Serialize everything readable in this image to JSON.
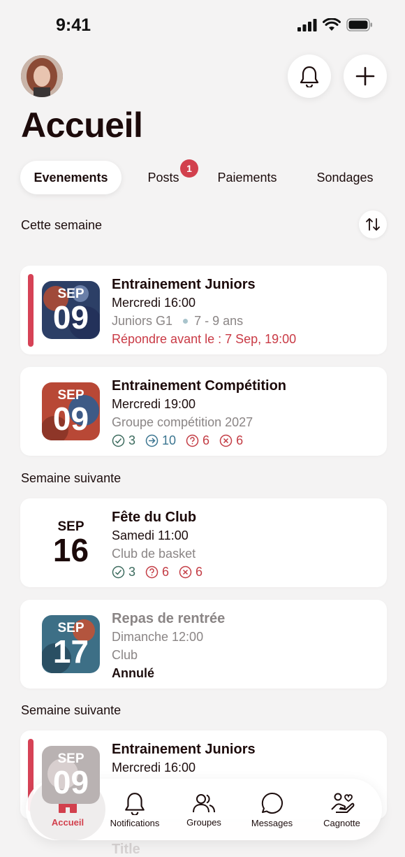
{
  "status": {
    "time": "9:41"
  },
  "header": {
    "title": "Accueil"
  },
  "tabs": [
    {
      "label": "Evenements",
      "active": true
    },
    {
      "label": "Posts",
      "badge": "1"
    },
    {
      "label": "Paiements"
    },
    {
      "label": "Sondages"
    }
  ],
  "sections": {
    "this_week": "Cette semaine",
    "next_week_1": "Semaine suivante",
    "next_week_2": "Semaine suivante"
  },
  "events": [
    {
      "month": "SEP",
      "day": "09",
      "title": "Entrainement Juniors",
      "when": "Mercredi 16:00",
      "group": "Juniors G1",
      "age": "7 - 9 ans",
      "deadline": "Répondre avant le : 7 Sep, 19:00"
    },
    {
      "month": "SEP",
      "day": "09",
      "title": "Entrainement Compétition",
      "when": "Mercredi 19:00",
      "group": "Groupe compétition 2027",
      "stats": {
        "yes": "3",
        "go": "10",
        "maybe": "6",
        "no": "6"
      }
    },
    {
      "month": "SEP",
      "day": "16",
      "title": "Fête du Club",
      "when": "Samedi 11:00",
      "group": "Club de basket",
      "stats": {
        "yes": "3",
        "maybe": "6",
        "no": "6"
      }
    },
    {
      "month": "SEP",
      "day": "17",
      "title": "Repas de rentrée",
      "when": "Dimanche 12:00",
      "group": "Club",
      "status": "Annulé"
    },
    {
      "month": "SEP",
      "day": "09",
      "title": "Entrainement Juniors",
      "when": "Mercredi 16:00"
    }
  ],
  "ghost_title": "Title",
  "nav": [
    {
      "label": "Accueil",
      "icon": "home-icon",
      "active": true
    },
    {
      "label": "Notifications",
      "icon": "bell-icon"
    },
    {
      "label": "Groupes",
      "icon": "users-icon"
    },
    {
      "label": "Messages",
      "icon": "chat-icon"
    },
    {
      "label": "Cagnotte",
      "icon": "hand-heart-icon"
    }
  ],
  "colors": {
    "accent": "#d2404d",
    "background": "#f4f3f3",
    "card": "#ffffff"
  }
}
